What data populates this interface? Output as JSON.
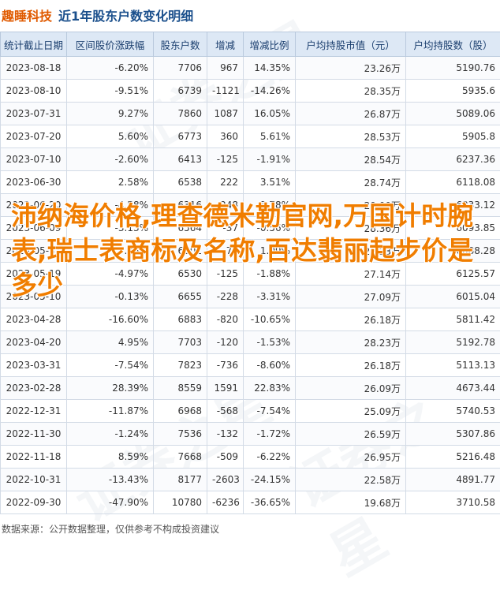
{
  "header": {
    "company": "趣睡科技",
    "title": "近1年股东户数变化明细"
  },
  "table": {
    "columns": [
      "统计截止日期",
      "区间股价涨跌幅",
      "股东户数",
      "增减",
      "增减比例",
      "户均持股市值（元）",
      "户均持股数（股）"
    ],
    "rows": [
      {
        "date": "2023-08-18",
        "pct": "-6.20%",
        "holders": "7706",
        "chg": "967",
        "chg_pct": "14.35%",
        "avg_value": "23.26万",
        "avg_shares": "5190.76"
      },
      {
        "date": "2023-08-10",
        "pct": "-9.51%",
        "holders": "6739",
        "chg": "-1121",
        "chg_pct": "-14.26%",
        "avg_value": "28.35万",
        "avg_shares": "5935.6"
      },
      {
        "date": "2023-07-31",
        "pct": "9.27%",
        "holders": "7860",
        "chg": "1087",
        "chg_pct": "16.05%",
        "avg_value": "26.87万",
        "avg_shares": "5089.06"
      },
      {
        "date": "2023-07-20",
        "pct": "5.60%",
        "holders": "6773",
        "chg": "360",
        "chg_pct": "5.61%",
        "avg_value": "28.53万",
        "avg_shares": "5905.8"
      },
      {
        "date": "2023-07-10",
        "pct": "-2.60%",
        "holders": "6413",
        "chg": "-125",
        "chg_pct": "-1.91%",
        "avg_value": "28.54万",
        "avg_shares": "6237.36"
      },
      {
        "date": "2023-06-30",
        "pct": "2.58%",
        "holders": "6538",
        "chg": "222",
        "chg_pct": "3.51%",
        "avg_value": "28.74万",
        "avg_shares": "6118.08"
      },
      {
        "date": "2023-06-20",
        "pct": "-4.58%",
        "holders": "6316",
        "chg": "-248",
        "chg_pct": "-3.78%",
        "avg_value": "29.00万",
        "avg_shares": "6333.12"
      },
      {
        "date": "2023-06-09",
        "pct": "-3.13%",
        "holders": "6564",
        "chg": "-37",
        "chg_pct": "-0.56%",
        "avg_value": "28.36万",
        "avg_shares": "6093.85"
      },
      {
        "date": "2023-05-31",
        "pct": "7.75%",
        "holders": "6601",
        "chg": "71",
        "chg_pct": "1.09%",
        "avg_value": "29.23万",
        "avg_shares": "6088.28"
      },
      {
        "date": "2023-05-19",
        "pct": "-4.97%",
        "holders": "6530",
        "chg": "-125",
        "chg_pct": "-1.88%",
        "avg_value": "27.14万",
        "avg_shares": "6125.57"
      },
      {
        "date": "2023-05-10",
        "pct": "-0.13%",
        "holders": "6655",
        "chg": "-228",
        "chg_pct": "-3.31%",
        "avg_value": "27.09万",
        "avg_shares": "6015.04"
      },
      {
        "date": "2023-04-28",
        "pct": "-16.60%",
        "holders": "6883",
        "chg": "-820",
        "chg_pct": "-10.65%",
        "avg_value": "26.18万",
        "avg_shares": "5811.42"
      },
      {
        "date": "2023-04-20",
        "pct": "4.95%",
        "holders": "7703",
        "chg": "-120",
        "chg_pct": "-1.53%",
        "avg_value": "28.23万",
        "avg_shares": "5192.78"
      },
      {
        "date": "2023-03-31",
        "pct": "-7.54%",
        "holders": "7823",
        "chg": "-736",
        "chg_pct": "-8.60%",
        "avg_value": "26.18万",
        "avg_shares": "5113.13"
      },
      {
        "date": "2023-02-28",
        "pct": "28.39%",
        "holders": "8559",
        "chg": "1591",
        "chg_pct": "22.83%",
        "avg_value": "26.09万",
        "avg_shares": "4673.44"
      },
      {
        "date": "2022-12-31",
        "pct": "-11.87%",
        "holders": "6968",
        "chg": "-568",
        "chg_pct": "-7.54%",
        "avg_value": "25.09万",
        "avg_shares": "5740.53"
      },
      {
        "date": "2022-11-30",
        "pct": "-1.24%",
        "holders": "7536",
        "chg": "-132",
        "chg_pct": "-1.72%",
        "avg_value": "26.59万",
        "avg_shares": "5307.86"
      },
      {
        "date": "2022-11-18",
        "pct": "8.59%",
        "holders": "7668",
        "chg": "-509",
        "chg_pct": "-6.22%",
        "avg_value": "26.95万",
        "avg_shares": "5216.48"
      },
      {
        "date": "2022-10-31",
        "pct": "-13.43%",
        "holders": "8177",
        "chg": "-2603",
        "chg_pct": "-24.15%",
        "avg_value": "22.58万",
        "avg_shares": "4891.77"
      },
      {
        "date": "2022-09-30",
        "pct": "-47.90%",
        "holders": "10780",
        "chg": "-6236",
        "chg_pct": "-36.65%",
        "avg_value": "19.68万",
        "avg_shares": "3710.58"
      }
    ]
  },
  "source": "数据来源：公开数据整理，仅供参考不构成投资建议",
  "watermark": "证券之星",
  "overlay": "沛纳海价格,理查德米勒官网,万国计时腕表,瑞士表商标及名称,百达翡丽起步价是多少",
  "colors": {
    "positive": "#e01818",
    "negative": "#169c28",
    "header_bg": "#dde8f5",
    "overlay": "#f07d00",
    "company": "#e05a00",
    "title": "#1a4f8c"
  }
}
